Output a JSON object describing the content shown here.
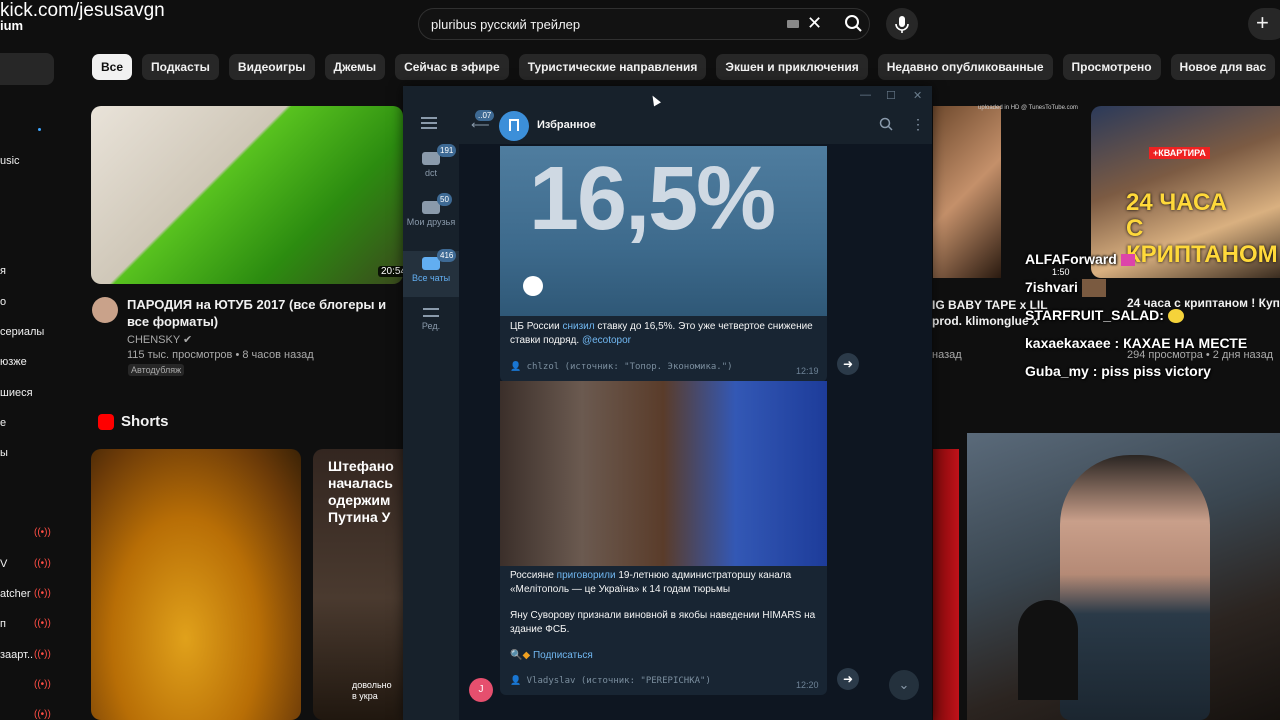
{
  "overlay": {
    "stream_url": "kick.com/jesusavgn",
    "logo_fragment": "ium"
  },
  "youtube": {
    "search": {
      "query": "pluribus русский трейлер"
    },
    "chips": [
      "Все",
      "Подкасты",
      "Видеоигры",
      "Джемы",
      "Сейчас в эфире",
      "Туристические направления",
      "Экшен и приключения",
      "Недавно опубликованные",
      "Просмотрено",
      "Новое для вас"
    ],
    "sidebar_fragments": [
      "usic",
      "я",
      "о",
      "сериалы",
      "юзже",
      "шиеся",
      "е",
      "ы",
      "V",
      "atcher",
      "п",
      "заарт.."
    ],
    "video": {
      "title": "ПАРОДИЯ на ЮТУБ 2017 (все блогеры и все форматы)",
      "channel": "CHENSKY",
      "meta": "115 тыс. просмотров • 8 часов назад",
      "badge": "Автодубляж",
      "duration": "20:54"
    },
    "shorts_label": "Shorts",
    "short2_title": "Штефано\nначалась\nодержим\nПутина У",
    "short2_caption": "довольно\nв укра",
    "right_video": {
      "title": "IG BABY TAPE x LIL\nprod. klimonglue x",
      "meta": "назад",
      "uploaded": "uploaded in HD @ TunesToTube.com"
    },
    "right_thumb": {
      "badge": "+КВАРТИРА",
      "title": "24 ЧАСА\nС КРИПТАНОМ"
    }
  },
  "stream_chat": [
    {
      "user": "ALFAForward",
      "text": ""
    },
    {
      "user": "7ishvari",
      "text": ""
    },
    {
      "user": "STARFRUIT_SALAD",
      "text": ": "
    },
    {
      "user": "kaxaekaxaee",
      "text": ": КАХАЕ НА МЕСТЕ"
    },
    {
      "user": "Guba_my",
      "text": ": piss piss victory"
    }
  ],
  "stream_chat_overlap": {
    "right_title": "24 часа с криптаном ! Купи",
    "right_meta": "294 просмотра • 2 дня назад",
    "time": "1:50"
  },
  "telegram": {
    "folders": [
      {
        "label": "dct",
        "badge": "191"
      },
      {
        "label": "Мои друзья",
        "badge": "50"
      },
      {
        "label": "Все чаты",
        "badge": "416"
      },
      {
        "label": "Ред.",
        "badge": ""
      }
    ],
    "back_badge": "..07",
    "chat_title": "Избранное",
    "messages": [
      {
        "image_text": "16,5%",
        "text_before": "ЦБ России ",
        "text_link": "снизил",
        "text_after": " ставку до 16,5%. Это уже четвертое снижение ставки подряд. ",
        "text_handle": "@ecotopor",
        "forward": "chlzol (источник: \"Топор. Экономика.\")",
        "time": "12:19"
      },
      {
        "text_before": "Россияне ",
        "text_link": "приговорили",
        "text_after": " 19-летнюю администраторшу канала «Мелітополь — це Україна» к 14 годам тюрьмы",
        "text2": "Яну Суворову признали виновной в якобы наведении HIMARS на здание ФСБ.",
        "subscribe": "Подписаться",
        "forward": "Vladyslav (источник: \"PEREPICHKA\")",
        "time": "12:20"
      }
    ],
    "avatar_letter": "J"
  }
}
